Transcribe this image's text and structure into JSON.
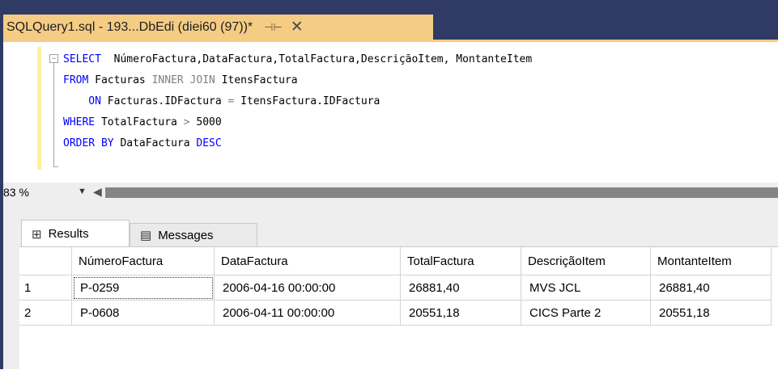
{
  "document_tab": {
    "title": "SQLQuery1.sql - 193...DbEdi (diei60 (97))*",
    "pin_icon": "pin-icon",
    "close_icon": "close-icon"
  },
  "editor": {
    "lines": [
      [
        {
          "t": "SELECT",
          "c": "kw"
        },
        {
          "t": "  NúmeroFactura,DataFactura,TotalFactura,DescriçãoItem, MontanteItem",
          "c": ""
        }
      ],
      [
        {
          "t": "FROM",
          "c": "kw"
        },
        {
          "t": " Facturas ",
          "c": ""
        },
        {
          "t": "INNER JOIN",
          "c": "gr"
        },
        {
          "t": " ItensFactura",
          "c": ""
        }
      ],
      [
        {
          "t": "    ON",
          "c": "kw"
        },
        {
          "t": " Facturas.IDFactura ",
          "c": ""
        },
        {
          "t": "=",
          "c": "gr"
        },
        {
          "t": " ItensFactura.IDFactura",
          "c": ""
        }
      ],
      [
        {
          "t": "WHERE",
          "c": "kw"
        },
        {
          "t": " TotalFactura ",
          "c": ""
        },
        {
          "t": ">",
          "c": "gr"
        },
        {
          "t": " 5000",
          "c": ""
        }
      ],
      [
        {
          "t": "ORDER BY",
          "c": "kw"
        },
        {
          "t": " DataFactura ",
          "c": ""
        },
        {
          "t": "DESC",
          "c": "kw"
        }
      ]
    ],
    "keyword_color": "#0000ff",
    "operator_color": "#808080"
  },
  "zoom": {
    "value": "83 %"
  },
  "results_tabs": {
    "results_label": "Results",
    "messages_label": "Messages"
  },
  "grid": {
    "columns": [
      "NúmeroFactura",
      "DataFactura",
      "TotalFactura",
      "DescriçãoItem",
      "MontanteItem"
    ],
    "rows": [
      {
        "num": "1",
        "cells": [
          "P-0259",
          "2006-04-16 00:00:00",
          "26881,40",
          "MVS JCL",
          "26881,40"
        ]
      },
      {
        "num": "2",
        "cells": [
          "P-0608",
          "2006-04-11 00:00:00",
          "20551,18",
          "CICS Parte 2",
          "20551,18"
        ]
      }
    ]
  },
  "colors": {
    "tab_active": "#f5cc84",
    "window_frame": "#2f3b65"
  }
}
